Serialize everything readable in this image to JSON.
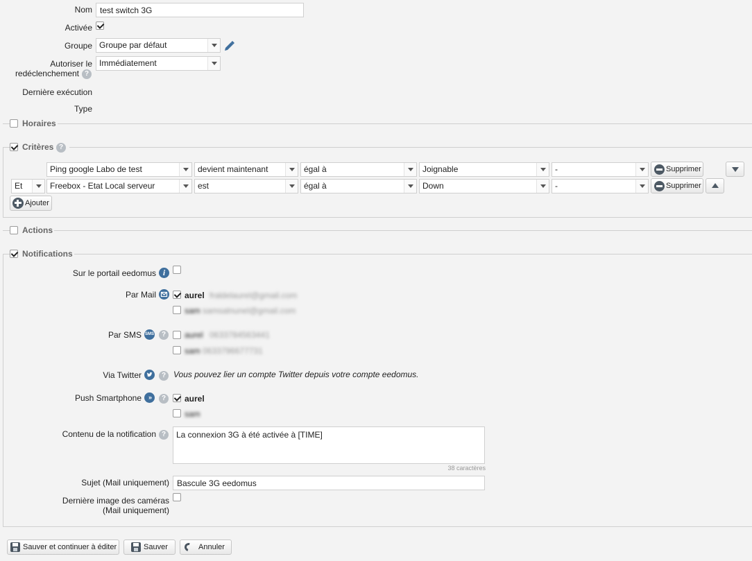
{
  "form": {
    "nom_label": "Nom",
    "nom_value": "test switch 3G",
    "activee_label": "Activée",
    "groupe_label": "Groupe",
    "groupe_value": "Groupe par défaut",
    "autoriser_label_1": "Autoriser le",
    "autoriser_label_2": "redéclenchement",
    "autoriser_value": "Immédiatement",
    "derniere_execution_label": "Dernière exécution",
    "type_label": "Type"
  },
  "sections": {
    "horaires": "Horaires",
    "criteres": "Critères",
    "actions": "Actions",
    "notifications": "Notifications"
  },
  "criteria": {
    "rows": [
      {
        "connector": "",
        "device": "Ping google Labo de test",
        "condition": "devient maintenant",
        "operator": "égal à",
        "value": "Joignable",
        "extra": "-"
      },
      {
        "connector": "Et",
        "device": "Freebox - Etat Local serveur",
        "condition": "est",
        "operator": "égal à",
        "value": "Down",
        "extra": "-"
      }
    ],
    "delete_label": "Supprimer",
    "add_label": "Ajouter"
  },
  "notifications": {
    "portail_label": "Sur le portail eedomus",
    "mail_label": "Par Mail",
    "mail_recipients": [
      {
        "name": "aurel",
        "contact": "fraldelaurel@gmail.com",
        "checked": true
      },
      {
        "name": "sam",
        "contact": "samsalnunel@gmail.com",
        "checked": false
      }
    ],
    "sms_label": "Par SMS",
    "sms_icon_text": "SMS",
    "sms_recipients": [
      {
        "name": "aurel",
        "contact": "0633784563441"
      },
      {
        "name": "sam",
        "contact": "0633796677731"
      }
    ],
    "twitter_label": "Via Twitter",
    "twitter_note": "Vous pouvez lier un compte Twitter depuis votre compte eedomus.",
    "push_label": "Push Smartphone",
    "push_recipients": [
      {
        "name": "aurel",
        "checked": true
      },
      {
        "name": "sam",
        "checked": false
      }
    ],
    "contenu_label": "Contenu de la notification",
    "contenu_value": "La connexion 3G à été activée à [TIME]",
    "char_count": "38 caractères",
    "sujet_label": "Sujet (Mail uniquement)",
    "sujet_value": "Bascule 3G eedomus",
    "camera_label_1": "Dernière image des caméras",
    "camera_label_2": "(Mail uniquement)"
  },
  "footer": {
    "save_continue": "Sauver et continuer à éditer",
    "save": "Sauver",
    "cancel": "Annuler"
  },
  "colors": {
    "background": "#f3f3f3",
    "icon_blue": "#3f6f9d",
    "help_grey": "#b8bec4"
  }
}
